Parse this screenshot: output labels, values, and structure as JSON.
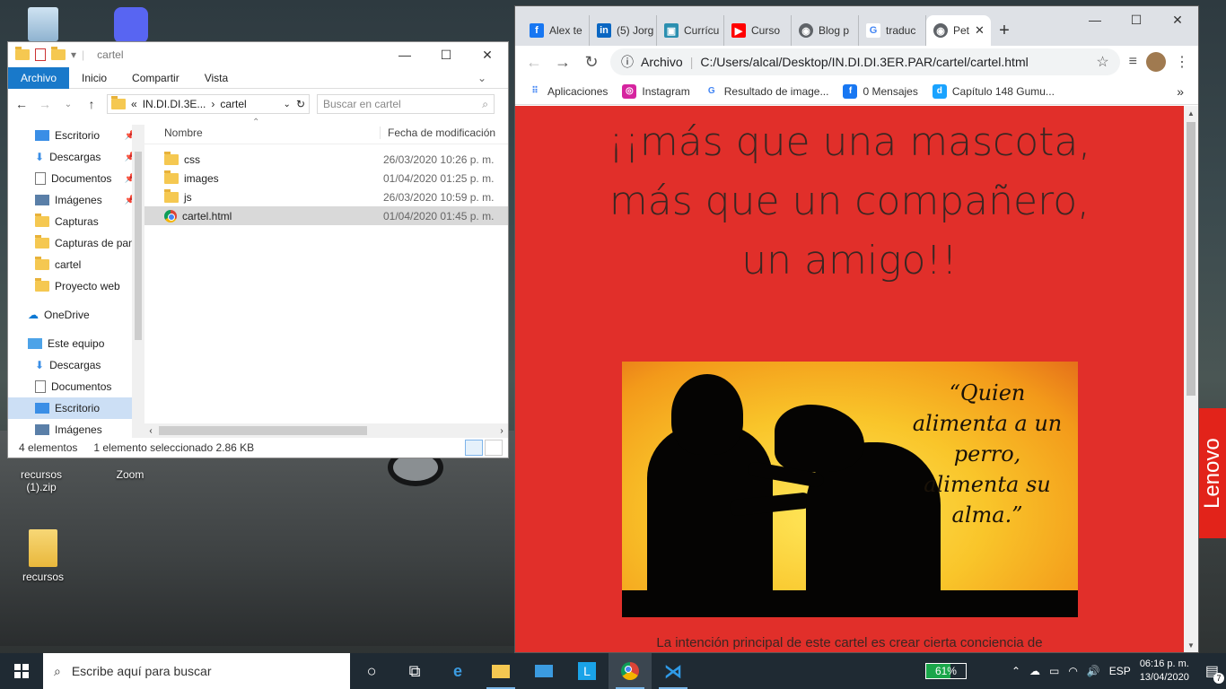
{
  "desktop": {
    "icons": [
      {
        "label": "recursos (1).zip"
      },
      {
        "label": "Zoom"
      },
      {
        "label": "recursos"
      }
    ],
    "lenovo": "Lenovo"
  },
  "explorer": {
    "title": "cartel",
    "ribbon_tabs": [
      "Archivo",
      "Inicio",
      "Compartir",
      "Vista"
    ],
    "address": {
      "prefix": "«",
      "part1": "IN.DI.DI.3E...",
      "sep": "›",
      "part2": "cartel"
    },
    "search_placeholder": "Buscar en cartel",
    "nav_items": [
      {
        "label": "Escritorio",
        "pinned": true
      },
      {
        "label": "Descargas",
        "pinned": true
      },
      {
        "label": "Documentos",
        "pinned": true
      },
      {
        "label": "Imágenes",
        "pinned": true
      },
      {
        "label": "Capturas"
      },
      {
        "label": "Capturas de pan"
      },
      {
        "label": "cartel"
      },
      {
        "label": "Proyecto web"
      },
      {
        "label": "OneDrive"
      },
      {
        "label": "Este equipo"
      },
      {
        "label": "Descargas"
      },
      {
        "label": "Documentos"
      },
      {
        "label": "Escritorio"
      },
      {
        "label": "Imágenes"
      }
    ],
    "columns": {
      "name": "Nombre",
      "date": "Fecha de modificación"
    },
    "files": [
      {
        "name": "css",
        "date": "26/03/2020 10:26 p. m."
      },
      {
        "name": "images",
        "date": "01/04/2020 01:25 p. m."
      },
      {
        "name": "js",
        "date": "26/03/2020 10:59 p. m."
      },
      {
        "name": "cartel.html",
        "date": "01/04/2020 01:45 p. m."
      }
    ],
    "status": {
      "count": "4 elementos",
      "selected": "1 elemento seleccionado  2.86 KB"
    }
  },
  "chrome": {
    "tabs": [
      {
        "label": "Alex te",
        "color": "#1877f2",
        "glyph": "f"
      },
      {
        "label": "(5) Jorg",
        "color": "#0a66c2",
        "glyph": "in"
      },
      {
        "label": "Currícu",
        "color": "#2b8fb0",
        "glyph": "▣"
      },
      {
        "label": "Curso",
        "color": "#ff0000",
        "glyph": "▶"
      },
      {
        "label": "Blog p",
        "color": "#5f6368",
        "glyph": "◉"
      },
      {
        "label": "traduc",
        "color": "#ffffff",
        "glyph": "G"
      },
      {
        "label": "Pet",
        "color": "#5f6368",
        "glyph": "◉"
      }
    ],
    "omnibox": {
      "label": "Archivo",
      "url": "C:/Users/alcal/Desktop/IN.DI.DI.3ER.PAR/cartel/cartel.html"
    },
    "bookmarks": [
      {
        "label": "Aplicaciones",
        "color": "#4285f4",
        "glyph": "⠿"
      },
      {
        "label": "Instagram",
        "color": "#d6249f",
        "glyph": "◎"
      },
      {
        "label": "Resultado de image...",
        "color": "#ffffff",
        "glyph": "G"
      },
      {
        "label": "0 Mensajes",
        "color": "#1877f2",
        "glyph": "f"
      },
      {
        "label": "Capítulo 148 Gumu...",
        "color": "#1aa3ff",
        "glyph": "d"
      }
    ],
    "page": {
      "heading": "¡¡más que una mascota, más que un compañero, un amigo!!",
      "quote": "“Quien alimenta a un perro, alimenta su alma.”",
      "caption": "La intención principal de este cartel es crear cierta conciencia de"
    }
  },
  "taskbar": {
    "search_placeholder": "Escribe aquí para buscar",
    "battery": "61%",
    "language": "ESP",
    "time": "06:16 p. m.",
    "date": "13/04/2020",
    "notifications": "7"
  }
}
